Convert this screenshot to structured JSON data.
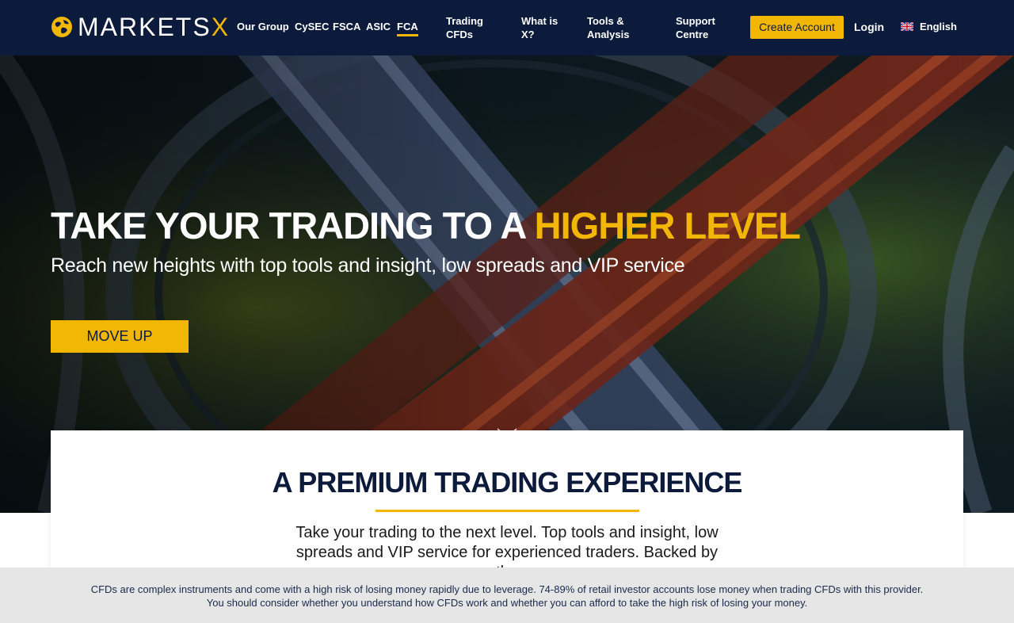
{
  "header": {
    "logo": {
      "brand": "MARKETS",
      "brand_x": "X"
    },
    "nav": {
      "our_group": "Our Group",
      "cysec": "CySEC",
      "fsca": "FSCA",
      "asic": "ASIC",
      "fca": "FCA",
      "trading_cfds": [
        "Trading",
        "CFDs"
      ],
      "what_is_x": [
        "What is",
        "X?"
      ],
      "tools_analysis": [
        "Tools &",
        "Analysis"
      ],
      "support_centre": [
        "Support",
        "Centre"
      ]
    },
    "create_account": "Create Account",
    "login": "Login",
    "language": "English",
    "active_tab": "FCA"
  },
  "hero": {
    "title_main": "TAKE YOUR TRADING TO A ",
    "title_accent": "HIGHER LEVEL",
    "subtitle": "Reach new heights with top tools and insight, low spreads and VIP service",
    "cta": "MOVE UP",
    "scroll_icon": "double-chevron-down-icon"
  },
  "card": {
    "title": "A PREMIUM TRADING EXPERIENCE",
    "text": "Take your trading to the next level. Top tools and insight, low spreads and VIP service for experienced traders. Backed by the"
  },
  "risk_warning": {
    "text": "CFDs are complex instruments and come with a high risk of losing money rapidly due to leverage. 74-89% of retail investor accounts lose money when trading CFDs with this provider. You should consider whether you understand how CFDs work and whether you can afford to take the high risk of losing your money."
  },
  "colors": {
    "navy": "#0c1a3b",
    "accent": "#f2b705",
    "banner": "#e6e6e6"
  }
}
